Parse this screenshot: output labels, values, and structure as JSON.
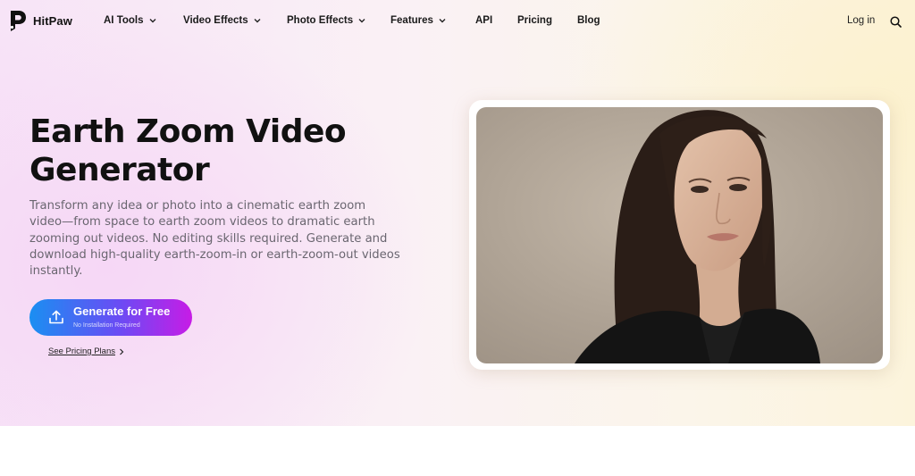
{
  "brand": {
    "name": "HitPaw"
  },
  "nav": {
    "items": [
      {
        "label": "AI Tools",
        "dropdown": true
      },
      {
        "label": "Video Effects",
        "dropdown": true
      },
      {
        "label": "Photo Effects",
        "dropdown": true
      },
      {
        "label": "Features",
        "dropdown": true
      },
      {
        "label": "API",
        "dropdown": false
      },
      {
        "label": "Pricing",
        "dropdown": false
      },
      {
        "label": "Blog",
        "dropdown": false
      }
    ],
    "login_label": "Log in",
    "search_icon": "search-icon"
  },
  "hero": {
    "title": "Earth Zoom Video Generator",
    "description": "Transform any idea or photo into a cinematic earth zoom video—from space to earth zoom videos to dramatic earth zooming out videos. No editing skills required. Generate and download high-quality earth-zoom-in or earth-zoom-out videos instantly.",
    "cta": {
      "label": "Generate for Free",
      "sublabel": "No Installation Required",
      "icon": "upload-icon"
    },
    "pricing_link": "See Pricing Plans"
  },
  "colors": {
    "cta_start": "#1a8ff2",
    "cta_end": "#c71ce6",
    "text_dark": "#111111",
    "text_muted": "#6a6670"
  }
}
